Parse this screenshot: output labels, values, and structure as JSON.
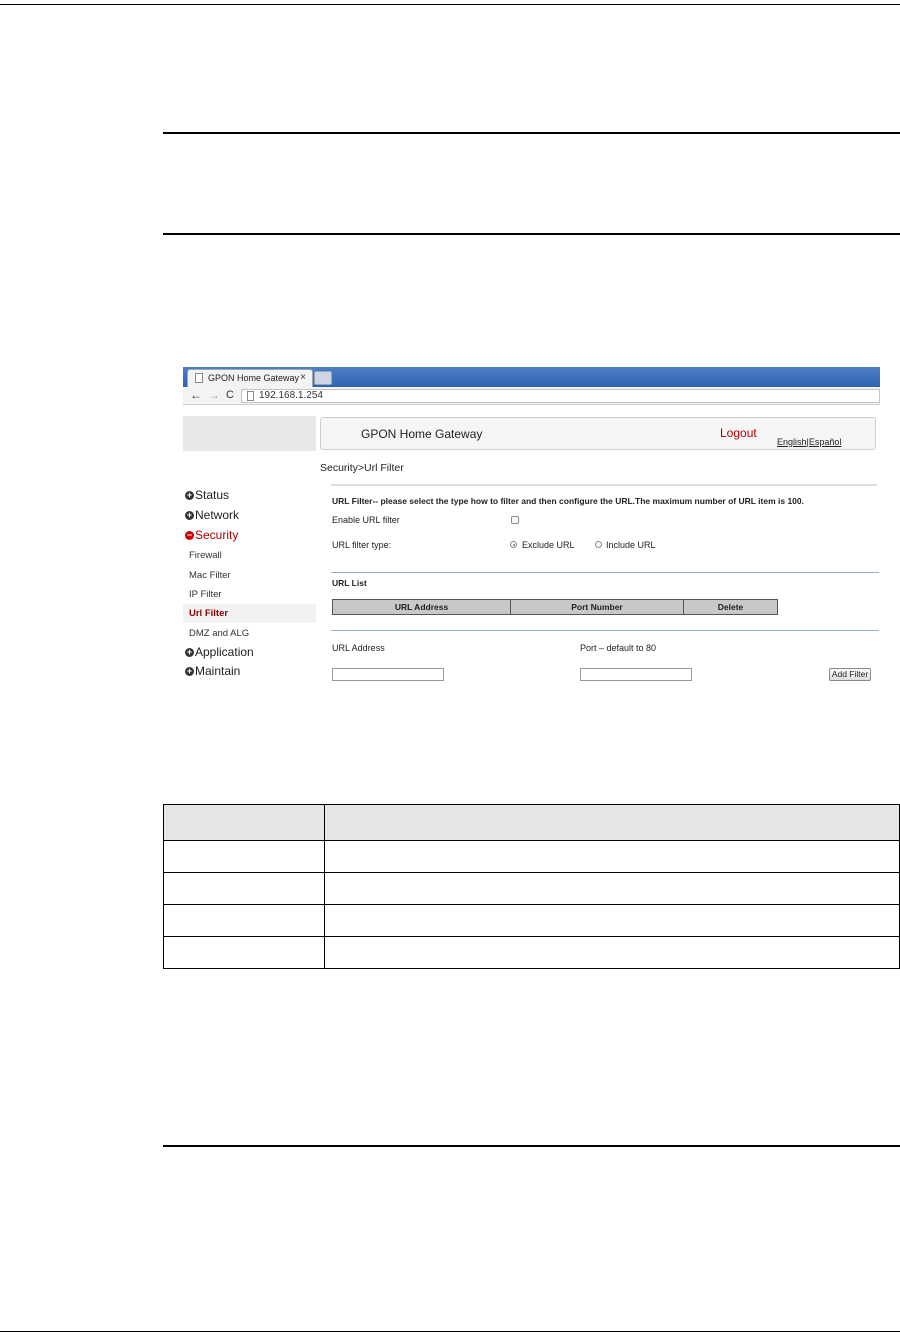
{
  "browser": {
    "tab_title": "GPON Home Gateway",
    "tab_close": "×",
    "address": "192.168.1.254",
    "back_glyph": "←",
    "forward_glyph": "→",
    "reload_glyph": "C"
  },
  "header": {
    "title": "GPON Home Gateway",
    "logout": "Logout",
    "lang_english": "English",
    "lang_sep": "|",
    "lang_spanish": "Español"
  },
  "breadcrumb": "Security>Url Filter",
  "sidebar": {
    "expand_symbol": "+",
    "collapse_symbol": "−",
    "items": [
      {
        "label": "Status",
        "expanded": false
      },
      {
        "label": "Network",
        "expanded": false
      },
      {
        "label": "Security",
        "expanded": true
      },
      {
        "label": "Application",
        "expanded": false
      },
      {
        "label": "Maintain",
        "expanded": false
      }
    ],
    "security_sub": [
      "Firewall",
      "Mac Filter",
      "IP Filter",
      "Url Filter",
      "DMZ and ALG"
    ],
    "active_sub": "Url Filter"
  },
  "url_filter": {
    "intro": "URL Filter-- please select the type how to filter and then configure the URL.The maximum number of URL item is 100.",
    "enable_label": "Enable URL filter",
    "enable_checked": false,
    "type_label": "URL filter type:",
    "type_options": [
      "Exclude URL",
      "Include URL"
    ],
    "type_selected": "Exclude URL",
    "list_title": "URL List",
    "columns": [
      "URL Address",
      "Port Number",
      "Delete"
    ],
    "addr_label": "URL Address",
    "port_label": "Port – default to 80",
    "add_button": "Add Filter",
    "addr_value": "",
    "port_value": ""
  },
  "colors": {
    "tabstrip": "#3a6cb8",
    "logout": "#b00000",
    "active_menu": "#8b0000",
    "table_header": "#c8c8c8"
  }
}
